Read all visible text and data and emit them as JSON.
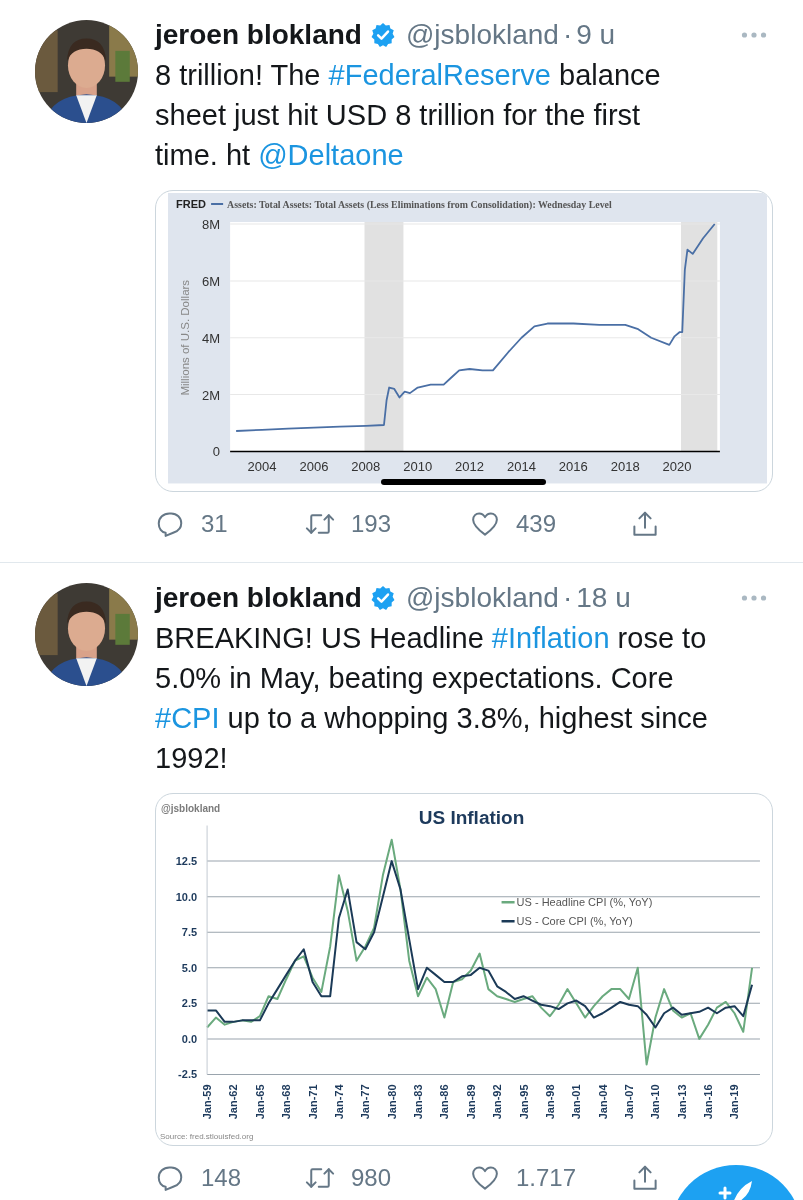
{
  "tweets": [
    {
      "author": {
        "name": "jeroen blokland",
        "verified": true,
        "handle": "@jsblokland",
        "separator": "·",
        "time": "9 u"
      },
      "text": [
        {
          "kind": "text",
          "text": "8 trillion! The "
        },
        {
          "kind": "hashtag",
          "text": "#FederalReserve"
        },
        {
          "kind": "text",
          "text": " balance sheet just hit USD 8 trillion for the first time. ht "
        },
        {
          "kind": "mention",
          "text": "@Deltaone"
        }
      ],
      "media": {
        "kind": "fred",
        "logo": "FRED",
        "chart_data": {
          "type": "line",
          "ylabel": "Millions of U.S. Dollars",
          "xlim": [
            2002.77,
            2021.65
          ],
          "ylim": [
            0,
            8
          ],
          "xticks": [
            2004,
            2006,
            2008,
            2010,
            2012,
            2014,
            2016,
            2018,
            2020
          ],
          "yticks": [
            {
              "value": 0,
              "label": "0"
            },
            {
              "value": 2,
              "label": "2M"
            },
            {
              "value": 4,
              "label": "4M"
            },
            {
              "value": 6,
              "label": "6M"
            },
            {
              "value": 8,
              "label": "8M"
            }
          ],
          "x": [
            2003,
            2004,
            2005,
            2006,
            2007,
            2008,
            2008.7,
            2008.8,
            2008.9,
            2009.1,
            2009.3,
            2009.5,
            2009.7,
            2010,
            2010.5,
            2011,
            2011.3,
            2011.6,
            2012,
            2012.5,
            2012.9,
            2013.5,
            2014,
            2014.5,
            2015,
            2016,
            2017,
            2018,
            2018.5,
            2019,
            2019.7,
            2019.9,
            2020.1,
            2020.2,
            2020.3,
            2020.4,
            2020.6,
            2021,
            2021.45
          ],
          "series": [
            {
              "name": "Assets: Total Assets: Total Assets (Less Eliminations from Consolidation): Wednesday Level",
              "color": "#4a6fa5",
              "values": [
                0.72,
                0.76,
                0.8,
                0.84,
                0.87,
                0.9,
                0.93,
                1.8,
                2.25,
                2.2,
                1.9,
                2.1,
                2.05,
                2.25,
                2.35,
                2.35,
                2.6,
                2.85,
                2.9,
                2.85,
                2.85,
                3.5,
                4.0,
                4.4,
                4.5,
                4.5,
                4.45,
                4.45,
                4.3,
                4.0,
                3.75,
                4.05,
                4.2,
                4.2,
                6.4,
                7.1,
                6.95,
                7.5,
                8.0
              ]
            }
          ],
          "grid": true,
          "bands": [
            {
              "axis": "x",
              "from": 2007.95,
              "to": 2009.45
            },
            {
              "axis": "x",
              "from": 2020.15,
              "to": 2021.55
            }
          ]
        }
      },
      "actions": [
        {
          "kind": "reply",
          "count": "31"
        },
        {
          "kind": "retweet",
          "count": "193"
        },
        {
          "kind": "like",
          "count": "439"
        },
        {
          "kind": "share"
        }
      ]
    },
    {
      "author": {
        "name": "jeroen blokland",
        "verified": true,
        "handle": "@jsblokland",
        "separator": "·",
        "time": "18 u"
      },
      "text": [
        {
          "kind": "text",
          "text": "BREAKING! US Headline "
        },
        {
          "kind": "hashtag",
          "text": "#Inflation"
        },
        {
          "kind": "text",
          "text": " rose to 5.0% in May, beating expectations. Core "
        },
        {
          "kind": "hashtag",
          "text": "#CPI"
        },
        {
          "kind": "text",
          "text": " up to a whopping 3.8%, highest since 1992!"
        }
      ],
      "media": {
        "kind": "branded",
        "watermark": "@jsblokland",
        "source": "Source: fred.stlouisfed.org",
        "chart_data": {
          "type": "line",
          "title": "US Inflation",
          "ylim": [
            -2.5,
            15
          ],
          "grid": true,
          "legend": true,
          "categories": [
            "Jan-59",
            null,
            null,
            "Jan-62",
            null,
            null,
            "Jan-65",
            null,
            null,
            "Jan-68",
            null,
            null,
            "Jan-71",
            null,
            null,
            "Jan-74",
            null,
            null,
            "Jan-77",
            null,
            null,
            "Jan-80",
            null,
            null,
            "Jan-83",
            null,
            null,
            "Jan-86",
            null,
            null,
            "Jan-89",
            null,
            null,
            "Jan-92",
            null,
            null,
            "Jan-95",
            null,
            null,
            "Jan-98",
            null,
            null,
            "Jan-01",
            null,
            null,
            "Jan-04",
            null,
            null,
            "Jan-07",
            null,
            null,
            "Jan-10",
            null,
            null,
            "Jan-13",
            null,
            null,
            "Jan-16",
            null,
            null,
            "Jan-19",
            null,
            null
          ],
          "yticks": [
            {
              "value": -2.5,
              "label": "-2.5"
            },
            {
              "value": 0,
              "label": "0.0"
            },
            {
              "value": 2.5,
              "label": "2.5"
            },
            {
              "value": 5,
              "label": "5.0"
            },
            {
              "value": 7.5,
              "label": "7.5"
            },
            {
              "value": 10,
              "label": "10.0"
            },
            {
              "value": 12.5,
              "label": "12.5"
            }
          ],
          "series": [
            {
              "name": "US - Headline CPI (%, YoY)",
              "color": "#6aaa7e",
              "values": [
                0.8,
                1.5,
                1.0,
                1.2,
                1.3,
                1.2,
                1.6,
                3.0,
                2.8,
                4.2,
                5.5,
                5.8,
                4.3,
                3.3,
                6.5,
                11.5,
                9.0,
                5.5,
                6.5,
                7.8,
                11.5,
                14.0,
                10.5,
                5.5,
                3.0,
                4.3,
                3.5,
                1.5,
                4.0,
                4.2,
                4.8,
                6.0,
                3.5,
                3.0,
                2.8,
                2.6,
                2.8,
                3.0,
                2.2,
                1.6,
                2.4,
                3.5,
                2.5,
                1.5,
                2.3,
                3.0,
                3.5,
                3.5,
                2.8,
                5.0,
                -1.8,
                1.5,
                3.5,
                2.0,
                1.5,
                1.8,
                0.0,
                1.0,
                2.2,
                2.6,
                1.8,
                0.5,
                5.0
              ]
            },
            {
              "name": "US - Core CPI (%, YoY)",
              "color": "#1b3a57",
              "values": [
                2.0,
                2.0,
                1.2,
                1.2,
                1.3,
                1.3,
                1.3,
                2.5,
                3.5,
                4.5,
                5.5,
                6.3,
                4.0,
                3.0,
                3.0,
                8.5,
                10.5,
                6.8,
                6.3,
                7.5,
                10.0,
                12.5,
                10.5,
                7.0,
                3.5,
                5.0,
                4.5,
                4.0,
                4.0,
                4.4,
                4.5,
                5.0,
                4.8,
                3.7,
                3.3,
                2.8,
                3.0,
                2.7,
                2.4,
                2.3,
                2.1,
                2.5,
                2.7,
                2.3,
                1.5,
                1.8,
                2.2,
                2.6,
                2.4,
                2.3,
                1.7,
                0.8,
                1.8,
                2.2,
                1.7,
                1.8,
                1.9,
                2.2,
                1.8,
                2.2,
                2.3,
                1.6,
                3.8
              ]
            }
          ]
        }
      },
      "actions": [
        {
          "kind": "reply",
          "count": "148"
        },
        {
          "kind": "retweet",
          "count": "980"
        },
        {
          "kind": "like",
          "count": "1.717"
        },
        {
          "kind": "share"
        }
      ]
    }
  ]
}
